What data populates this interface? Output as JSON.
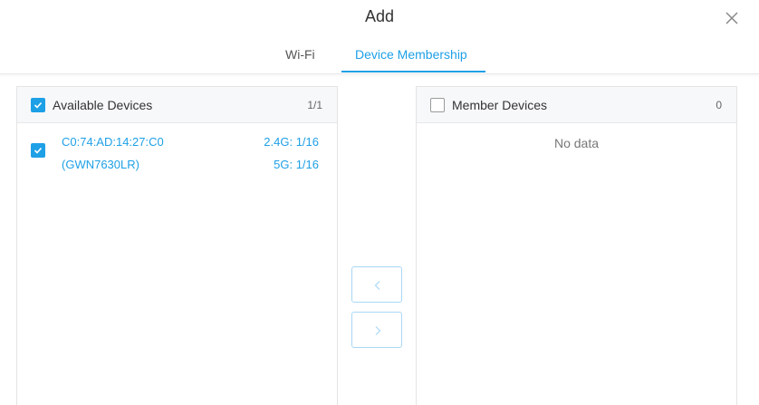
{
  "modal": {
    "title": "Add",
    "close_icon": "close-icon"
  },
  "tabs": [
    {
      "label": "Wi-Fi",
      "active": false
    },
    {
      "label": "Device Membership",
      "active": true
    }
  ],
  "available": {
    "title": "Available Devices",
    "count": "1/1",
    "all_checked": true,
    "devices": [
      {
        "mac": "C0:74:AD:14:27:C0",
        "model": "(GWN7630LR)",
        "band_24": "2.4G: 1/16",
        "band_5": "5G: 1/16",
        "checked": true
      }
    ]
  },
  "members": {
    "title": "Member Devices",
    "count": "0",
    "all_checked": false,
    "empty_text": "No data"
  },
  "transfer": {
    "left_icon": "chevron-left-icon",
    "right_icon": "chevron-right-icon"
  },
  "colors": {
    "accent": "#1ea0e6",
    "border": "#e4e4e4",
    "header_bg": "#f7f8fa"
  }
}
